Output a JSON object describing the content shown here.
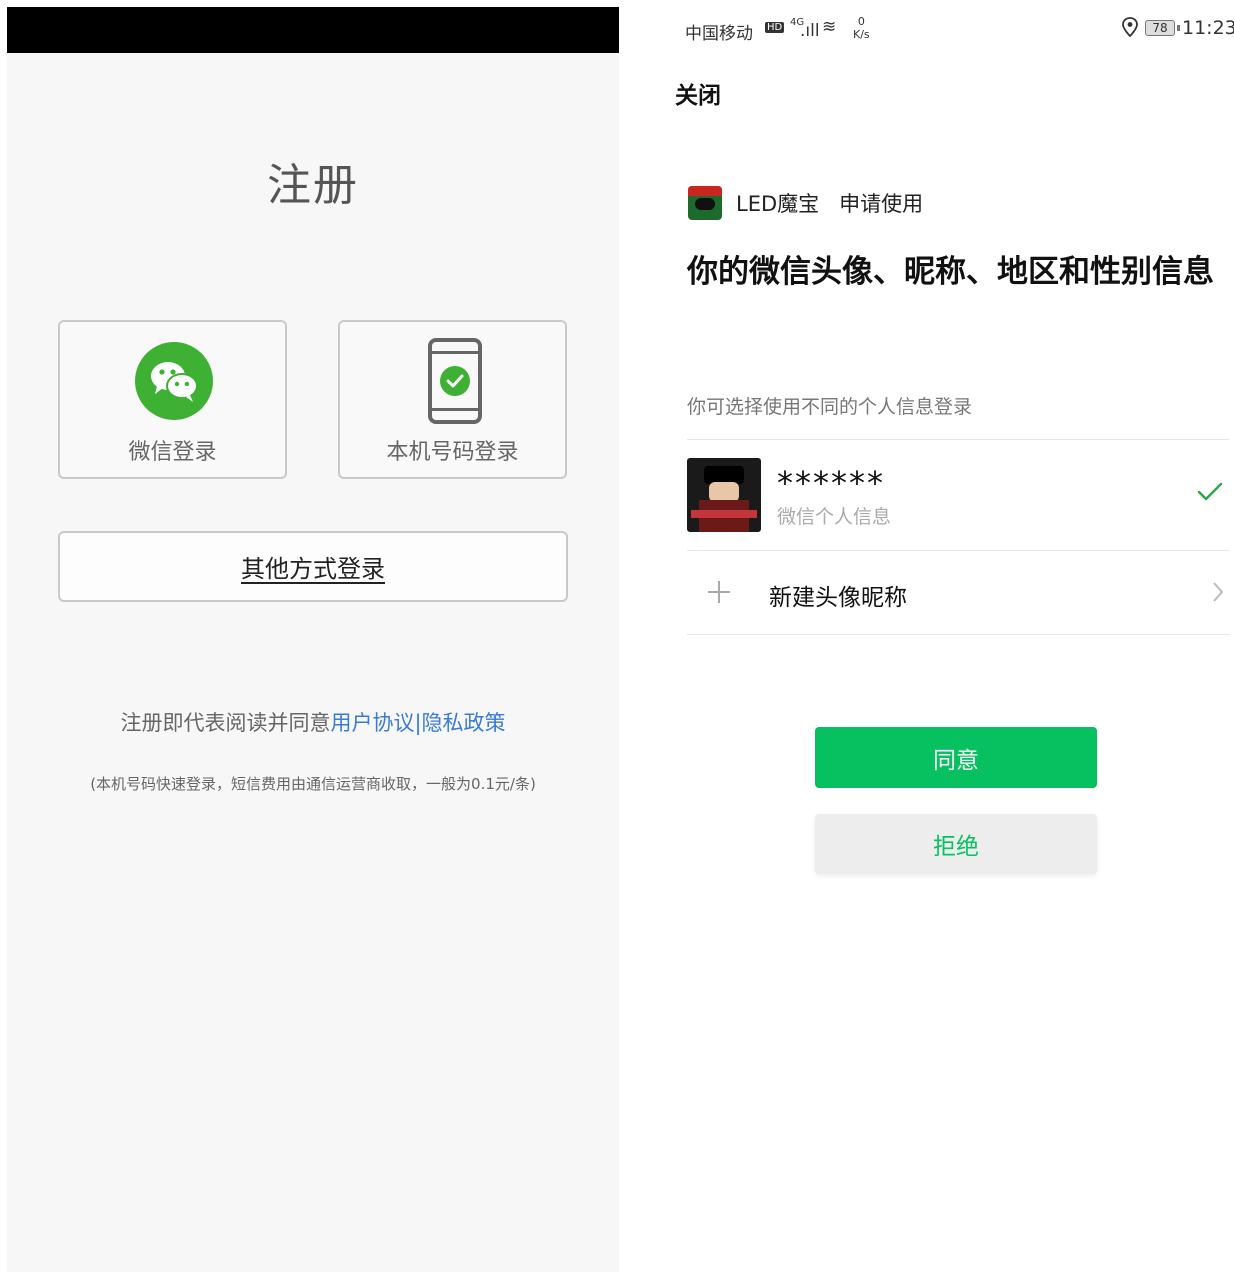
{
  "left": {
    "title": "注册",
    "wechat_login_label": "微信登录",
    "phone_login_label": "本机号码登录",
    "other_login_label": "其他方式登录",
    "agreement_prefix": "注册即代表阅读并同意",
    "user_agreement_link": "用户协议",
    "separator": "|",
    "privacy_link": "隐私政策",
    "sms_note": "(本机号码快速登录，短信费用由通信运营商收取，一般为0.1元/条)"
  },
  "status_bar": {
    "carrier": "中国移动",
    "hd": "HD",
    "network": "4G",
    "signal": ".ıll",
    "wifi": "≋",
    "speed_value": "0",
    "speed_unit": "K/s",
    "location_icon": "location-icon",
    "battery": "78",
    "time": "11:23"
  },
  "right": {
    "close_label": "关闭",
    "app_name": "LED魔宝",
    "request_text": "申请使用",
    "headline": "你的微信头像、昵称、地区和性别信息",
    "subline": "你可选择使用不同的个人信息登录",
    "profile_nickname": "******",
    "profile_sub": "微信个人信息",
    "new_profile_label": "新建头像昵称",
    "agree_button": "同意",
    "reject_button": "拒绝"
  },
  "colors": {
    "wechat_green": "#07c160",
    "icon_green": "#3eb135",
    "link_blue": "#3a7bd5"
  }
}
